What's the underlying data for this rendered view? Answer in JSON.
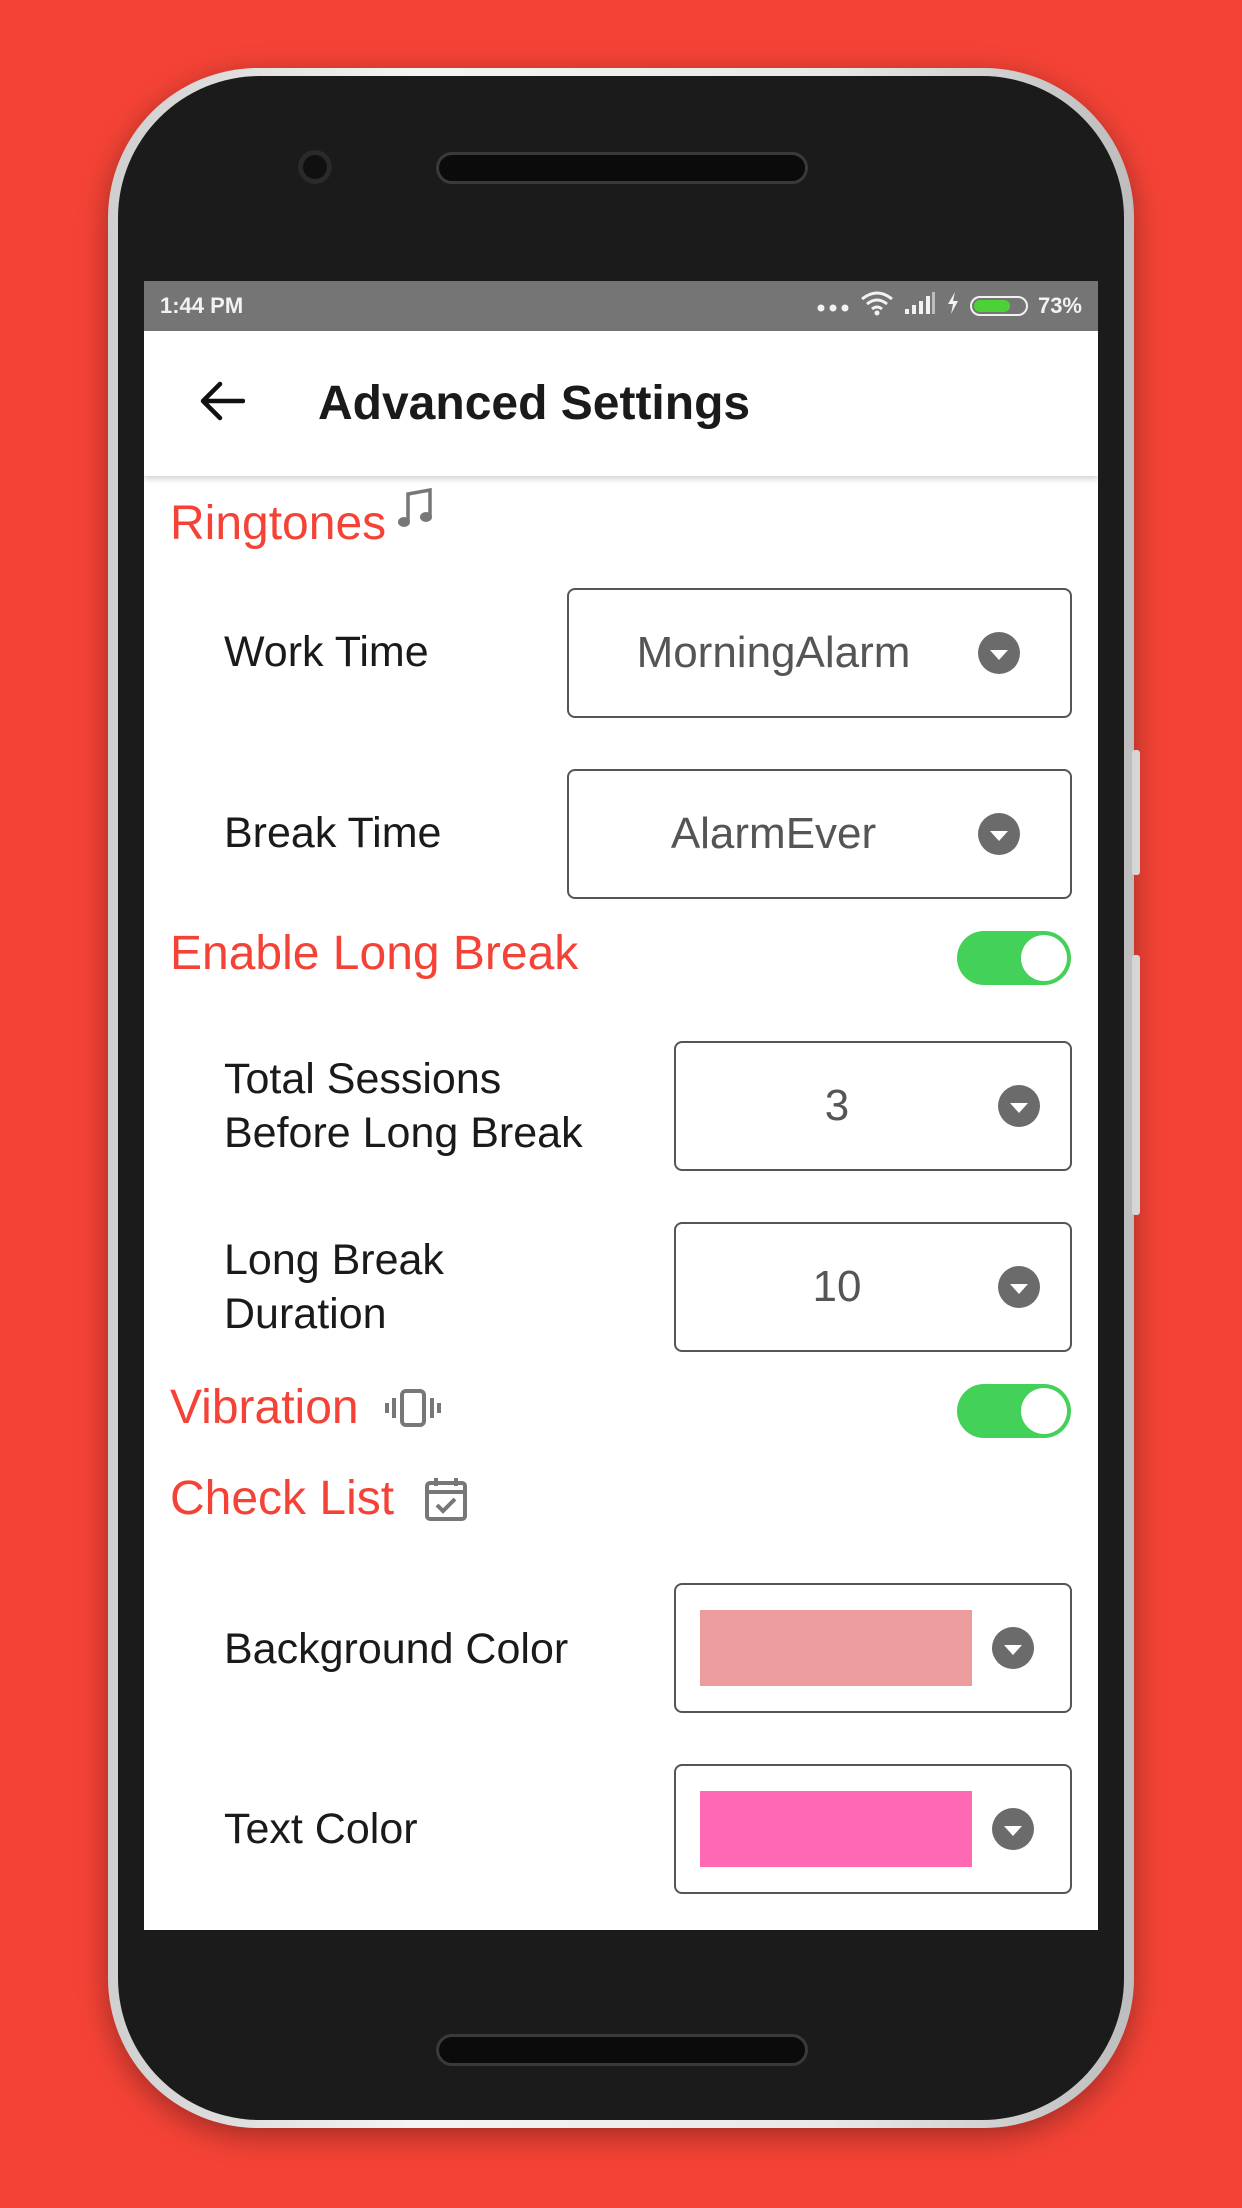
{
  "status_bar": {
    "time": "1:44 PM",
    "battery": "73%",
    "battery_level": 0.73
  },
  "app_bar": {
    "title": "Advanced Settings",
    "back_icon": "arrow-left-icon"
  },
  "sections": {
    "ringtones": {
      "title": "Ringtones",
      "icon": "music-note-icon",
      "work_time": {
        "label": "Work Time",
        "value": "MorningAlarm"
      },
      "break_time": {
        "label": "Break Time",
        "value": "AlarmEver"
      }
    },
    "long_break": {
      "title": "Enable Long Break",
      "enabled": true,
      "total_sessions": {
        "label_line1": "Total Sessions",
        "label_line2": "Before Long Break",
        "value": "3"
      },
      "duration": {
        "label_line1": "Long Break",
        "label_line2": "Duration",
        "value": "10"
      }
    },
    "vibration": {
      "title": "Vibration",
      "icon": "vibration-icon",
      "enabled": true
    },
    "check_list": {
      "title": "Check List",
      "icon": "calendar-check-icon",
      "background_color": {
        "label": "Background Color",
        "value": "#EC9C9C"
      },
      "text_color": {
        "label": "Text Color",
        "value": "#FF69B4"
      }
    }
  },
  "colors": {
    "accent": "#F44336",
    "toggle_on": "#43D15A",
    "page_bg": "#F44336"
  }
}
